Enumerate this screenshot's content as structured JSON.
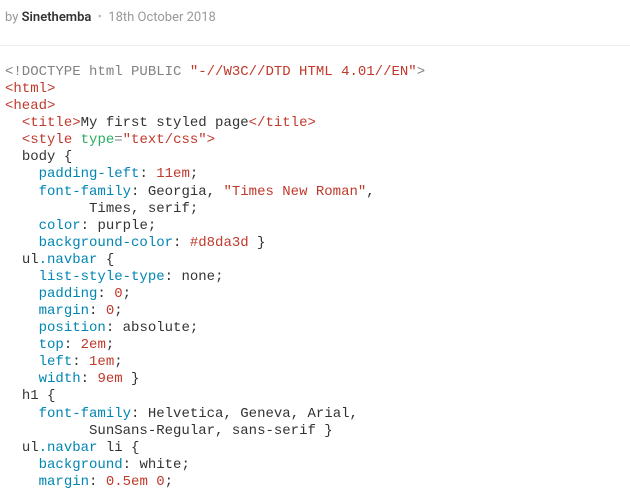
{
  "header": {
    "by": "by",
    "author": "Sinethemba",
    "sep": "•",
    "date": "18th October 2018"
  },
  "code": {
    "doctype_open": "<!DOCTYPE html PUBLIC ",
    "doctype_str": "\"-//W3C//DTD HTML 4.01//EN\"",
    "doctype_close": ">",
    "html_open": "<html>",
    "head_open": "<head>",
    "title_open": "<title>",
    "title_text": "My first styled page",
    "title_close": "</title>",
    "style_open_lt": "<style",
    "style_attr_name": "type",
    "style_attr_eq": "=",
    "style_attr_val": "\"text/css\"",
    "style_open_gt": ">",
    "body_sel": "body {",
    "pl_prop": "padding-left",
    "pl_val": "11em",
    "ff_prop": "font-family",
    "ff_body_1": "Georgia",
    "ff_body_str": "\"Times New Roman\"",
    "ff_body_2": "Times",
    "ff_body_3": "serif",
    "color_prop": "color",
    "color_body_val": "purple",
    "bgc_prop": "background-color",
    "bgc_body_val": "#d8da3d",
    "ulnav_sel_ul": "ul",
    "ulnav_sel_class": ".navbar",
    "lst_prop": "list-style-type",
    "lst_val": "none",
    "pad_prop": "padding",
    "pad_val0": "0",
    "mar_prop": "margin",
    "mar_val0": "0",
    "pos_prop": "position",
    "pos_val": "absolute",
    "top_prop": "top",
    "top_val": "2em",
    "left_prop": "left",
    "left_val": "1em",
    "width_prop": "width",
    "width_val": "9em",
    "h1_sel": "h1 {",
    "ff_h1_1": "Helvetica",
    "ff_h1_2": "Geneva",
    "ff_h1_3": "Arial",
    "ff_h1_4": "SunSans-Regular",
    "ff_h1_5": "sans-serif",
    "li_sel_li": " li {",
    "bg_prop": "background",
    "bg_li_val": "white",
    "mar_li_val": "0.5em 0"
  }
}
